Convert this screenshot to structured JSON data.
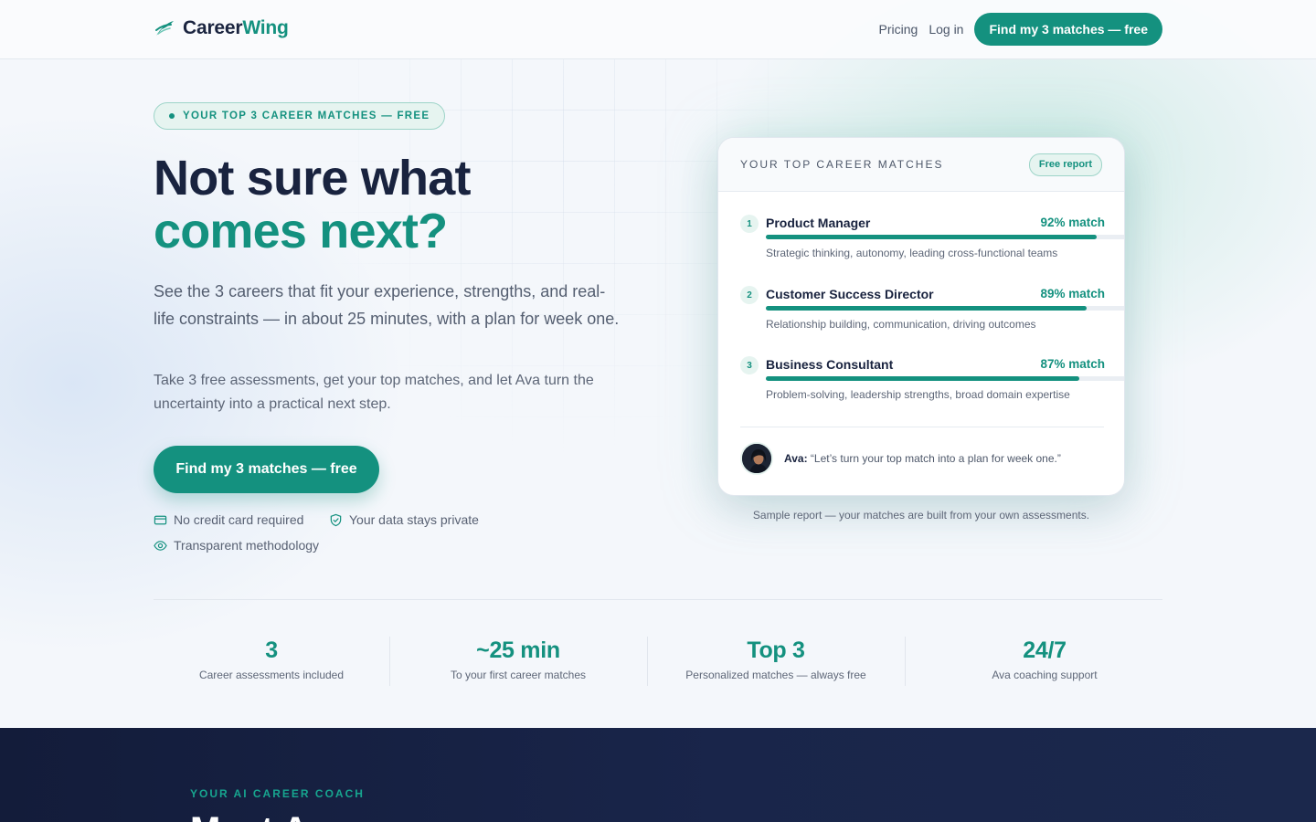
{
  "header": {
    "logo_primary": "Career",
    "logo_accent": "Wing",
    "nav_pricing": "Pricing",
    "nav_login": "Log in",
    "cta": "Find my 3 matches — free"
  },
  "hero": {
    "badge": "YOUR TOP 3 CAREER MATCHES — FREE",
    "title_line1": "Not sure what",
    "title_line2": "comes next?",
    "lead": "See the 3 careers that fit your experience, strengths, and real-life constraints — in about 25 minutes, with a plan for week one.",
    "sub": "Take 3 free assessments, get your top matches, and let Ava turn the uncertainty into a practical next step.",
    "cta": "Find my 3 matches — free",
    "trust": [
      {
        "icon": "credit-card-icon",
        "label": "No credit card required"
      },
      {
        "icon": "shield-check-icon",
        "label": "Your data stays private"
      },
      {
        "icon": "eye-icon",
        "label": "Transparent methodology"
      }
    ]
  },
  "report": {
    "title": "YOUR TOP CAREER MATCHES",
    "pill": "Free report",
    "matches": [
      {
        "rank": "1",
        "title": "Product Manager",
        "match_label": "92% match",
        "match": 92,
        "desc": "Strategic thinking, autonomy, leading cross-functional teams"
      },
      {
        "rank": "2",
        "title": "Customer Success Director",
        "match_label": "89% match",
        "match": 89,
        "desc": "Relationship building, communication, driving outcomes"
      },
      {
        "rank": "3",
        "title": "Business Consultant",
        "match_label": "87% match",
        "match": 87,
        "desc": "Problem-solving, leadership strengths, broad domain expertise"
      }
    ],
    "ava_name": "Ava:",
    "ava_quote": "“Let’s turn your top match into a plan for week one.”",
    "caption": "Sample report — your matches are built from your own assessments."
  },
  "stats": [
    {
      "value": "3",
      "label": "Career assessments included"
    },
    {
      "value": "~25 min",
      "label": "To your first career matches"
    },
    {
      "value": "Top 3",
      "label": "Personalized matches — always free"
    },
    {
      "value": "24/7",
      "label": "Ava coaching support"
    }
  ],
  "coach_section": {
    "eyebrow": "YOUR AI CAREER COACH",
    "heading": "Meet Ava"
  },
  "colors": {
    "accent": "#14917f",
    "navy": "#19233f",
    "dark_band": "#131c3a"
  }
}
